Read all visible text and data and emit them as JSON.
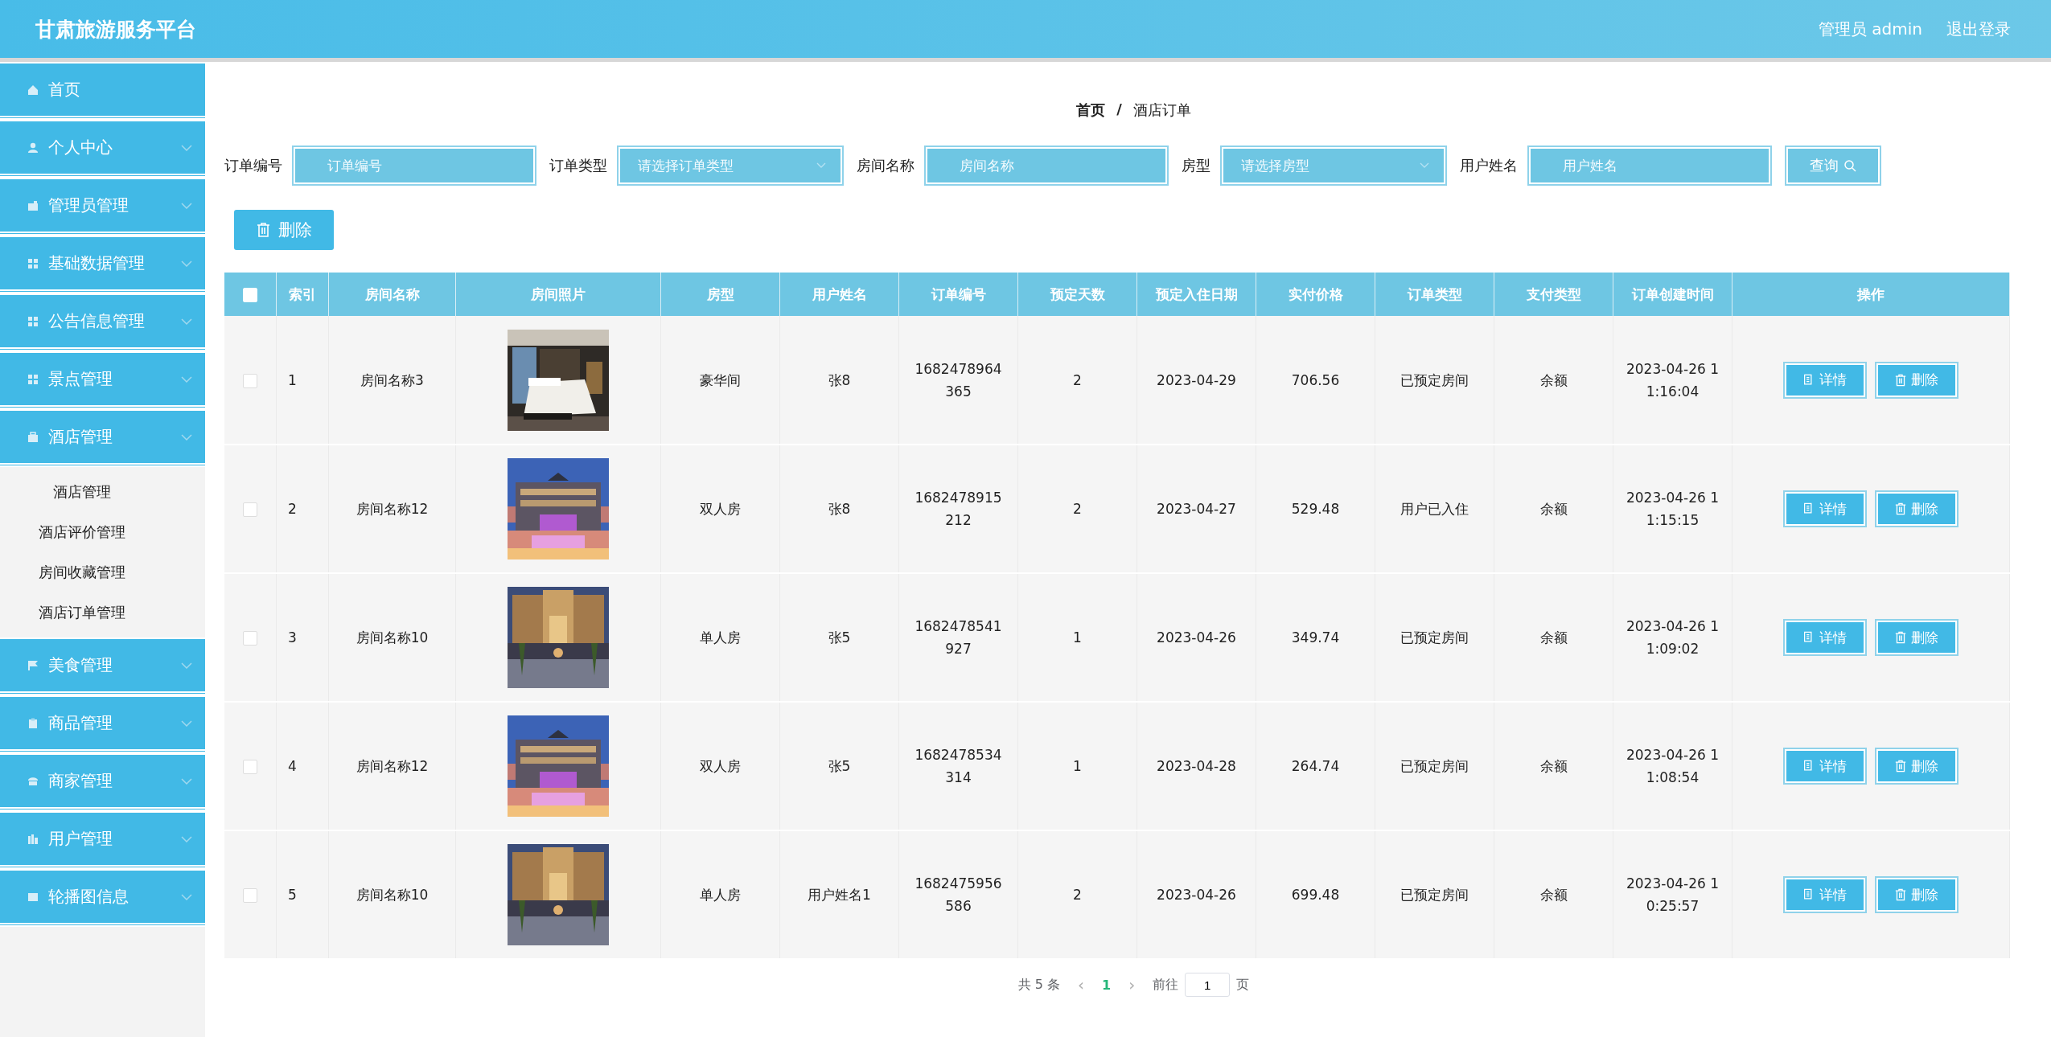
{
  "header": {
    "title": "甘肃旅游服务平台",
    "user": "管理员 admin",
    "logout": "退出登录"
  },
  "sidebar": {
    "items": [
      {
        "label": "首页",
        "has_children": false
      },
      {
        "label": "个人中心",
        "expanded": false,
        "has_children": true
      },
      {
        "label": "管理员管理",
        "expanded": false,
        "has_children": true
      },
      {
        "label": "基础数据管理",
        "expanded": false,
        "has_children": true
      },
      {
        "label": "公告信息管理",
        "expanded": false,
        "has_children": true
      },
      {
        "label": "景点管理",
        "expanded": false,
        "has_children": true
      },
      {
        "label": "酒店管理",
        "expanded": true,
        "has_children": true,
        "children": [
          {
            "label": "酒店管理"
          },
          {
            "label": "酒店评价管理"
          },
          {
            "label": "房间收藏管理"
          },
          {
            "label": "酒店订单管理"
          }
        ]
      },
      {
        "label": "美食管理",
        "expanded": false,
        "has_children": true
      },
      {
        "label": "商品管理",
        "expanded": false,
        "has_children": true
      },
      {
        "label": "商家管理",
        "expanded": false,
        "has_children": true
      },
      {
        "label": "用户管理",
        "expanded": false,
        "has_children": true
      },
      {
        "label": "轮播图信息",
        "expanded": false,
        "has_children": true
      }
    ]
  },
  "breadcrumb": {
    "items": [
      "首页",
      "酒店订单"
    ],
    "separator": "/"
  },
  "filters": [
    {
      "kind": "text",
      "label": "订单编号",
      "placeholder": "订单编号"
    },
    {
      "kind": "select",
      "label": "订单类型",
      "placeholder": "请选择订单类型"
    },
    {
      "kind": "text",
      "label": "房间名称",
      "placeholder": "房间名称"
    },
    {
      "kind": "select",
      "label": "房型",
      "placeholder": "请选择房型"
    },
    {
      "kind": "text",
      "label": "用户姓名",
      "placeholder": "用户姓名"
    }
  ],
  "search_button": "查询",
  "delete_button": "删除",
  "table": {
    "header_checkbox": {
      "checked": false
    },
    "columns": [
      "索引",
      "房间名称",
      "房间照片",
      "房型",
      "用户姓名",
      "订单编号",
      "预定天数",
      "预定入住日期",
      "实付价格",
      "订单类型",
      "支付类型",
      "订单创建时间",
      "操作"
    ],
    "rows": [
      {
        "checked": false,
        "cells": [
          "1",
          "房间名称3",
          {
            "kind": "picture"
          },
          "豪华间",
          "张8",
          "1682478964365",
          "2",
          "2023-04-29",
          "706.56",
          "已预定房间",
          "余额",
          "2023-04-26 11:16:04"
        ],
        "actions": [
          "详情",
          "删除"
        ]
      },
      {
        "checked": false,
        "cells": [
          "2",
          "房间名称12",
          {
            "kind": "picture"
          },
          "双人房",
          "张8",
          "1682478915212",
          "2",
          "2023-04-27",
          "529.48",
          "用户已入住",
          "余额",
          "2023-04-26 11:15:15"
        ],
        "actions": [
          "详情",
          "删除"
        ]
      },
      {
        "checked": false,
        "cells": [
          "3",
          "房间名称10",
          {
            "kind": "picture"
          },
          "单人房",
          "张5",
          "1682478541927",
          "1",
          "2023-04-26",
          "349.74",
          "已预定房间",
          "余额",
          "2023-04-26 11:09:02"
        ],
        "actions": [
          "详情",
          "删除"
        ]
      },
      {
        "checked": false,
        "cells": [
          "4",
          "房间名称12",
          {
            "kind": "picture"
          },
          "双人房",
          "张5",
          "1682478534314",
          "1",
          "2023-04-28",
          "264.74",
          "已预定房间",
          "余额",
          "2023-04-26 11:08:54"
        ],
        "actions": [
          "详情",
          "删除"
        ]
      },
      {
        "checked": false,
        "cells": [
          "5",
          "房间名称10",
          {
            "kind": "picture"
          },
          "单人房",
          "用户姓名1",
          "1682475956586",
          "2",
          "2023-04-26",
          "699.48",
          "已预定房间",
          "余额",
          "2023-04-26 10:25:57"
        ],
        "actions": [
          "详情",
          "删除"
        ]
      }
    ]
  },
  "pagination": {
    "total": "共 5 条",
    "prev": "‹",
    "pages": [
      {
        "label": "1",
        "selected": true
      }
    ],
    "next": "›",
    "goto": "前往",
    "page_input": "1",
    "page_suffix": "页"
  }
}
